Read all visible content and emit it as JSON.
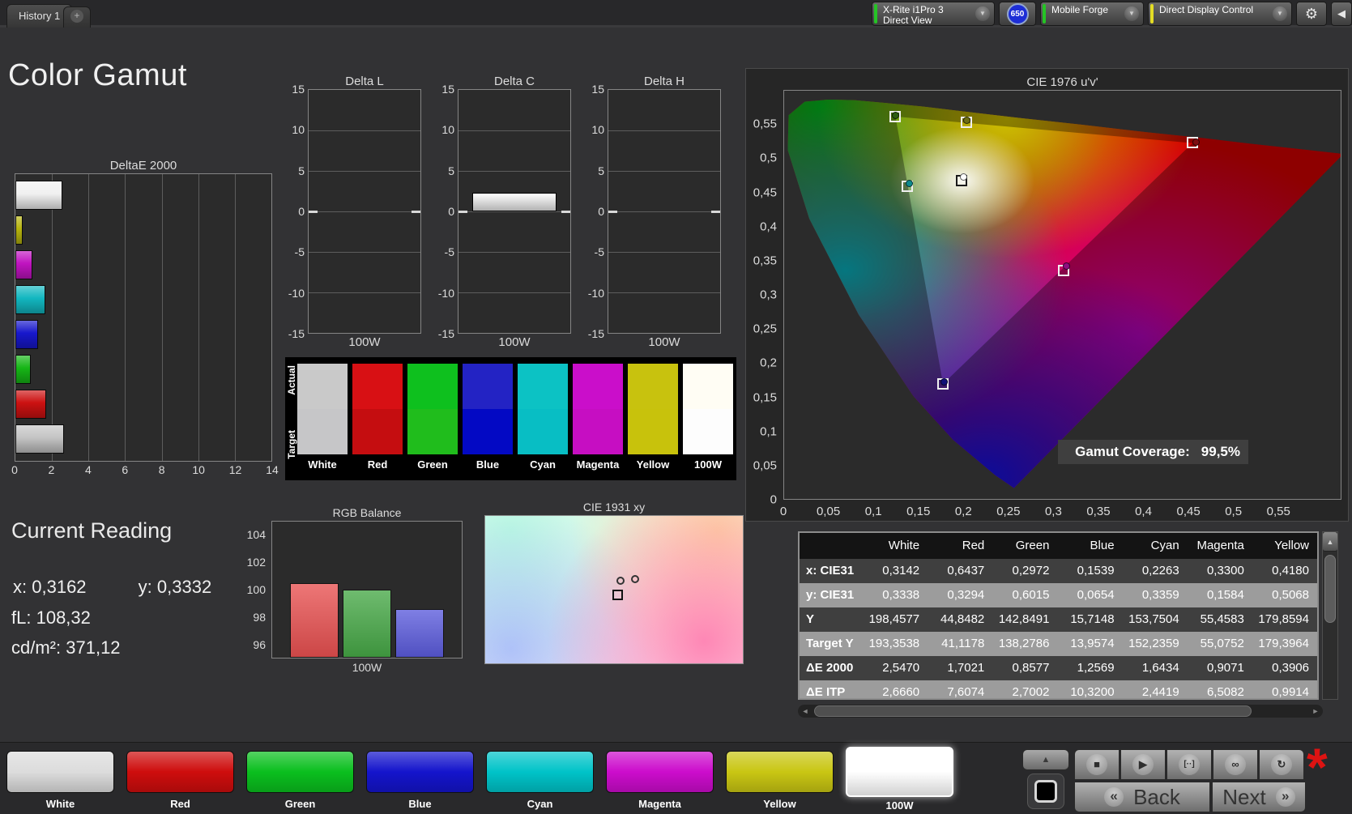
{
  "header": {
    "tab": "History 1",
    "new_tab": "+",
    "meter": {
      "line1": "X-Rite i1Pro 3",
      "line2": "Direct View",
      "status_color": "#25c425"
    },
    "badge": "650",
    "source_label": "Mobile Forge",
    "source_status_color": "#25c425",
    "control_label": "Direct Display Control",
    "control_status_color": "#e3dc25"
  },
  "page_title": "Color Gamut",
  "current_reading": {
    "title": "Current Reading",
    "x_label": "x:",
    "x_value": "0,3162",
    "y_label": "y:",
    "y_value": "0,3332",
    "fl_label": "fL:",
    "fl_value": "108,32",
    "cd_label": "cd/m²:",
    "cd_value": "371,12"
  },
  "swatch_compare": {
    "row_labels": [
      "Actual",
      "Target"
    ],
    "columns": [
      {
        "label": "White",
        "actual": "#c9c9c9",
        "target": "#c6c6c8"
      },
      {
        "label": "Red",
        "actual": "#d81014",
        "target": "#c50d10"
      },
      {
        "label": "Green",
        "actual": "#0ec01e",
        "target": "#20bd1c"
      },
      {
        "label": "Blue",
        "actual": "#2323c4",
        "target": "#0309c4"
      },
      {
        "label": "Cyan",
        "actual": "#0cc2c4",
        "target": "#08bec4"
      },
      {
        "label": "Magenta",
        "actual": "#ca0eca",
        "target": "#c60ec2"
      },
      {
        "label": "Yellow",
        "actual": "#c8c20e",
        "target": "#c8c20c"
      },
      {
        "label": "100W",
        "actual": "#fffdf4",
        "target": "#fdfdfd"
      }
    ]
  },
  "chart_data": [
    {
      "type": "bar",
      "orientation": "horizontal",
      "title": "DeltaE 2000",
      "categories": [
        "White",
        "Yellow",
        "Magenta",
        "Cyan",
        "Blue",
        "Green",
        "Red",
        "100W"
      ],
      "values": [
        2.55,
        0.39,
        0.91,
        1.64,
        1.26,
        0.86,
        1.7,
        2.66
      ],
      "colors": [
        "#f0f0f0",
        "#b7b40f",
        "#c013c0",
        "#12b7c0",
        "#1717cc",
        "#16b616",
        "#cc1111",
        "#c4c4c4"
      ],
      "xlim": [
        0,
        14
      ],
      "xticks": [
        "0",
        "2",
        "4",
        "6",
        "8",
        "10",
        "12",
        "14"
      ]
    },
    {
      "type": "bar",
      "title": "Delta L",
      "xlabel": "100W",
      "categories": [
        "100W"
      ],
      "values": [
        0
      ],
      "ylim": [
        -15,
        15
      ],
      "yticks": {
        "values": [
          15,
          10,
          5,
          0,
          -5,
          -10,
          -15
        ],
        "labels": [
          "15",
          "10",
          "5",
          "0",
          "-5",
          "-10",
          "-15"
        ]
      }
    },
    {
      "type": "bar",
      "title": "Delta C",
      "xlabel": "100W",
      "categories": [
        "100W"
      ],
      "values": [
        2.3
      ],
      "ylim": [
        -15,
        15
      ],
      "yticks": {
        "values": [
          15,
          10,
          5,
          0,
          -5,
          -10,
          -15
        ],
        "labels": [
          "15",
          "10",
          "5",
          "0",
          "-5",
          "-10",
          "-15"
        ]
      }
    },
    {
      "type": "bar",
      "title": "Delta H",
      "xlabel": "100W",
      "categories": [
        "100W"
      ],
      "values": [
        0
      ],
      "ylim": [
        -15,
        15
      ],
      "yticks": {
        "values": [
          15,
          10,
          5,
          0,
          -5,
          -10,
          -15
        ],
        "labels": [
          "15",
          "10",
          "5",
          "0",
          "-5",
          "-10",
          "-15"
        ]
      }
    },
    {
      "type": "scatter",
      "title": "CIE 1976 u'v'",
      "xlim": [
        0,
        0.62
      ],
      "ylim": [
        0,
        0.6
      ],
      "xticks": {
        "values": [
          0,
          0.05,
          0.1,
          0.15,
          0.2,
          0.25,
          0.3,
          0.35,
          0.4,
          0.45,
          0.5,
          0.55
        ],
        "labels": [
          "0",
          "0,05",
          "0,1",
          "0,15",
          "0,2",
          "0,25",
          "0,3",
          "0,35",
          "0,4",
          "0,45",
          "0,5",
          "0,55"
        ]
      },
      "yticks": {
        "values": [
          0.55,
          0.5,
          0.45,
          0.4,
          0.35,
          0.3,
          0.25,
          0.2,
          0.15,
          0.1,
          0.05,
          0
        ],
        "labels": [
          "0,55",
          "0,5",
          "0,45",
          "0,4",
          "0,35",
          "0,3",
          "0,25",
          "0,2",
          "0,15",
          "0,1",
          "0,05",
          "0"
        ]
      },
      "points": [
        {
          "name": "White",
          "u": 0.1978,
          "v": 0.4683,
          "square": "#1a1a1a",
          "dot": "#ffffff",
          "dx": 3,
          "dy": -4
        },
        {
          "name": "Red",
          "u": 0.4545,
          "v": 0.5233,
          "square": "#f0f0f0",
          "dot": "#7d0d10",
          "dx": 5,
          "dy": 0
        },
        {
          "name": "Green",
          "u": 0.1235,
          "v": 0.5625,
          "square": "#f0f0f0",
          "dot": "#2e5c12",
          "dx": 1,
          "dy": -1
        },
        {
          "name": "Blue",
          "u": 0.1771,
          "v": 0.1693,
          "square": "#f0f0f0",
          "dot": "#101078",
          "dx": 2,
          "dy": -2
        },
        {
          "name": "Cyan",
          "u": 0.1376,
          "v": 0.4595,
          "square": "#f0f0f0",
          "dot": "#0d8a8e",
          "dx": 3,
          "dy": -3
        },
        {
          "name": "Magenta",
          "u": 0.3113,
          "v": 0.3362,
          "square": "#f0f0f0",
          "dot": "#8e0d80",
          "dx": 4,
          "dy": -5
        },
        {
          "name": "Yellow",
          "u": 0.2028,
          "v": 0.5532,
          "square": "#f0f0f0",
          "dot": "#6e6e12",
          "dx": 1,
          "dy": -2
        }
      ],
      "coverage_label": "Gamut Coverage:",
      "coverage_value": "99,5%"
    },
    {
      "type": "bar",
      "title": "RGB Balance",
      "xlabel": "100W",
      "categories": [
        "Red",
        "Green",
        "Blue"
      ],
      "values": [
        100.5,
        100.0,
        98.6
      ],
      "colors": [
        "#e85050",
        "#46a846",
        "#5b5bdc"
      ],
      "ylim": [
        95,
        105
      ],
      "yticks": {
        "values": [
          104,
          102,
          100,
          98,
          96
        ],
        "labels": [
          "104",
          "102",
          "100",
          "98",
          "96"
        ]
      }
    },
    {
      "type": "scatter",
      "title": "CIE 1931 xy",
      "markers": [
        {
          "shape": "circle",
          "x": 51.0,
          "y": 41.0
        },
        {
          "shape": "circle",
          "x": 56.5,
          "y": 40.0
        },
        {
          "shape": "square",
          "x": 49.5,
          "y": 50.0
        }
      ]
    }
  ],
  "table": {
    "columns": [
      "",
      "White",
      "Red",
      "Green",
      "Blue",
      "Cyan",
      "Magenta",
      "Yellow"
    ],
    "rows": [
      {
        "label": "x: CIE31",
        "values": [
          "0,3142",
          "0,6437",
          "0,2972",
          "0,1539",
          "0,2263",
          "0,3300",
          "0,4180"
        ]
      },
      {
        "label": "y: CIE31",
        "values": [
          "0,3338",
          "0,3294",
          "0,6015",
          "0,0654",
          "0,3359",
          "0,1584",
          "0,5068"
        ]
      },
      {
        "label": "Y",
        "values": [
          "198,4577",
          "44,8482",
          "142,8491",
          "15,7148",
          "153,7504",
          "55,4583",
          "179,8594"
        ]
      },
      {
        "label": "Target Y",
        "values": [
          "193,3538",
          "41,1178",
          "138,2786",
          "13,9574",
          "152,2359",
          "55,0752",
          "179,3964"
        ]
      },
      {
        "label": "ΔE 2000",
        "values": [
          "2,5470",
          "1,7021",
          "0,8577",
          "1,2569",
          "1,6434",
          "0,9071",
          "0,3906"
        ]
      },
      {
        "label": "ΔE ITP",
        "values": [
          "2,6660",
          "7,6074",
          "2,7002",
          "10,3200",
          "2,4419",
          "6,5082",
          "0,9914"
        ]
      }
    ]
  },
  "bottom": {
    "patterns": [
      {
        "label": "White",
        "color": "#dcdcdc",
        "selected": false
      },
      {
        "label": "Red",
        "color": "#ce0d0d",
        "selected": false
      },
      {
        "label": "Green",
        "color": "#0abf1e",
        "selected": false
      },
      {
        "label": "Blue",
        "color": "#1414cc",
        "selected": false
      },
      {
        "label": "Cyan",
        "color": "#00c3c8",
        "selected": false
      },
      {
        "label": "Magenta",
        "color": "#cc0ccc",
        "selected": false
      },
      {
        "label": "Yellow",
        "color": "#c9c613",
        "selected": false
      },
      {
        "label": "100W",
        "color": "#ffffff",
        "selected": true
      }
    ],
    "transport": [
      {
        "name": "stop-icon",
        "glyph": "■"
      },
      {
        "name": "play-icon",
        "glyph": "▶"
      },
      {
        "name": "step-icon",
        "glyph": "[··]"
      },
      {
        "name": "loop-icon",
        "glyph": "∞"
      },
      {
        "name": "refresh-icon",
        "glyph": "↻"
      }
    ],
    "back": "Back",
    "next": "Next"
  }
}
